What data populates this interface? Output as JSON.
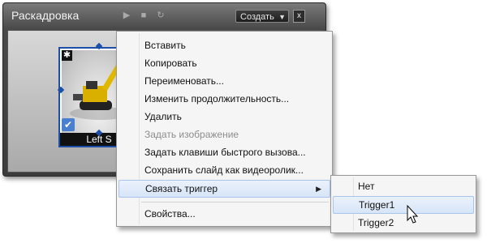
{
  "panel": {
    "title": "Раскадровка",
    "create_label": "Создать",
    "close_label": "x",
    "play_icon": "play-icon",
    "stop_icon": "stop-icon",
    "reload_icon": "reload-icon"
  },
  "slide": {
    "label": "Left S",
    "star": "✱",
    "check": "✔"
  },
  "menu": {
    "items": [
      {
        "label": "Вставить",
        "disabled": false
      },
      {
        "label": "Копировать",
        "disabled": false
      },
      {
        "label": "Переименовать...",
        "disabled": false
      },
      {
        "label": "Изменить продолжительность...",
        "disabled": false
      },
      {
        "label": "Удалить",
        "disabled": false
      },
      {
        "label": "Задать изображение",
        "disabled": true
      },
      {
        "label": "Задать клавиши быстрого вызова...",
        "disabled": false
      },
      {
        "label": "Сохранить слайд как видеоролик...",
        "disabled": false
      },
      {
        "label": "Связать триггер",
        "disabled": false,
        "highlighted": true,
        "submenu": true
      },
      {
        "label": "Свойства...",
        "disabled": false
      }
    ]
  },
  "submenu": {
    "items": [
      {
        "label": "Нет"
      },
      {
        "label": "Trigger1",
        "highlighted": true
      },
      {
        "label": "Trigger2"
      }
    ]
  },
  "colors": {
    "selection_border": "#1b4fa8",
    "highlight_bg": "#d7e5f8"
  }
}
